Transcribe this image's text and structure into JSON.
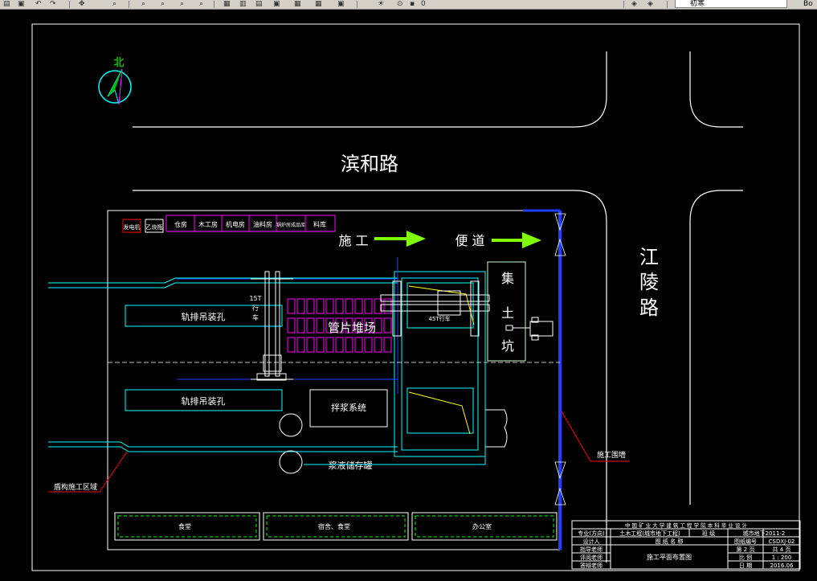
{
  "toolbar": {
    "layer_value": "初寒",
    "right_value": "Bo",
    "tools": [
      "open-icon",
      "save-icon",
      "undo-icon",
      "redo-icon",
      "pan-icon",
      "zoom-realtime-icon",
      "zoom-window-icon",
      "zoom-previous-icon",
      "zoom-extents-icon",
      "properties-icon",
      "design-center-icon",
      "tool-palettes-icon",
      "sheetset-icon",
      "markup-icon",
      "calc-icon",
      "layer-icon",
      "layer-state-icon"
    ]
  },
  "north": "北",
  "roads": {
    "binhe": "滨和路",
    "jiangling": [
      "江",
      "陵",
      "路"
    ]
  },
  "legend": {
    "items": [
      "发电机",
      "乙炔瓶"
    ],
    "rooms": [
      "仓房",
      "木工房",
      "机电房",
      "油料房",
      "锅炉房成品库",
      "料库"
    ]
  },
  "temp_road": {
    "part1": "施  工",
    "part2": "便  道"
  },
  "labels": {
    "crane_small": [
      "15T",
      "行",
      "车"
    ],
    "crane_big": "45T行车",
    "segment_yard": "管片堆场",
    "hole_top": "轨排吊装孔",
    "hole_bottom": "轨排吊装孔",
    "grout_system": "拌浆系统",
    "slurry_storage": "浆液储存罐",
    "muck_pit": [
      "集",
      "土",
      "坑"
    ],
    "shield_zone": "盾构施工区域",
    "fence": "施工围墙"
  },
  "buildings": [
    "食堂",
    "宿舍、食堂",
    "办公室"
  ],
  "title_block": {
    "school": "中 国 矿 业 大 学 建 筑 工 程 学 院 本 科 毕 业 设 计",
    "rows": [
      [
        "专业(方向)",
        "土木工程(城市地下工程)",
        "班 级",
        "城市地下2011-2"
      ],
      [
        "设计人",
        "图 纸 名 称",
        "图纸编号",
        "CSDXJ-02"
      ],
      [
        "指导老师",
        "",
        "第 2 页",
        "共 4 页"
      ],
      [
        "评阅老师",
        "施工平面布置图",
        "比 例",
        "1 : 200"
      ],
      [
        "答辩老师",
        "",
        "日 期",
        "2016.06"
      ]
    ]
  },
  "colors": {
    "background": "#000000",
    "frame": "#ffffff",
    "site": "#ffffff",
    "cyan": "#00ffff",
    "magenta": "#ff00ff",
    "green": "#00ff00",
    "yellow": "#ffff00",
    "blue": "#2040ff",
    "red": "#ff0000",
    "arrow": "#80ff00",
    "pale_green": "#c8ffc8"
  }
}
